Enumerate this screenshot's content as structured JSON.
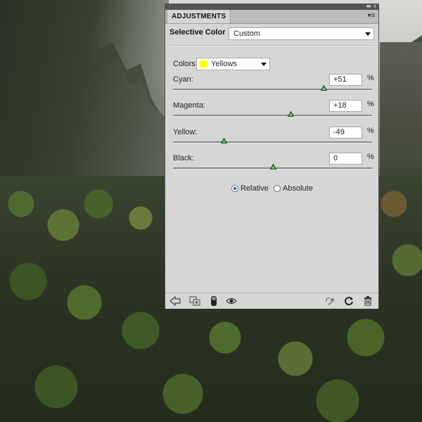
{
  "panel": {
    "tab_label": "ADJUSTMENTS",
    "collapse_glyph": "◂◂",
    "close_glyph": "x",
    "menu_glyph": "▾≡",
    "preset_label": "Selective Color",
    "preset_value": "Custom",
    "colors_label": "Colors:",
    "colors_value": "Yellows",
    "colors_swatch": "#ffff00",
    "sliders": [
      {
        "label": "Cyan:",
        "value": "+51",
        "unit": "%",
        "level": 51
      },
      {
        "label": "Magenta:",
        "value": "+18",
        "unit": "%",
        "level": 18
      },
      {
        "label": "Yellow:",
        "value": "-49",
        "unit": "%",
        "level": -49
      },
      {
        "label": "Black:",
        "value": "0",
        "unit": "%",
        "level": 0
      }
    ],
    "method": {
      "relative_label": "Relative",
      "absolute_label": "Absolute",
      "selected": "relative"
    },
    "footer_icons": [
      "back-arrow-icon",
      "clip-to-layer-icon",
      "layer-mask-icon",
      "visibility-eye-icon",
      "view-previous-state-icon",
      "reset-icon",
      "trash-icon"
    ]
  }
}
